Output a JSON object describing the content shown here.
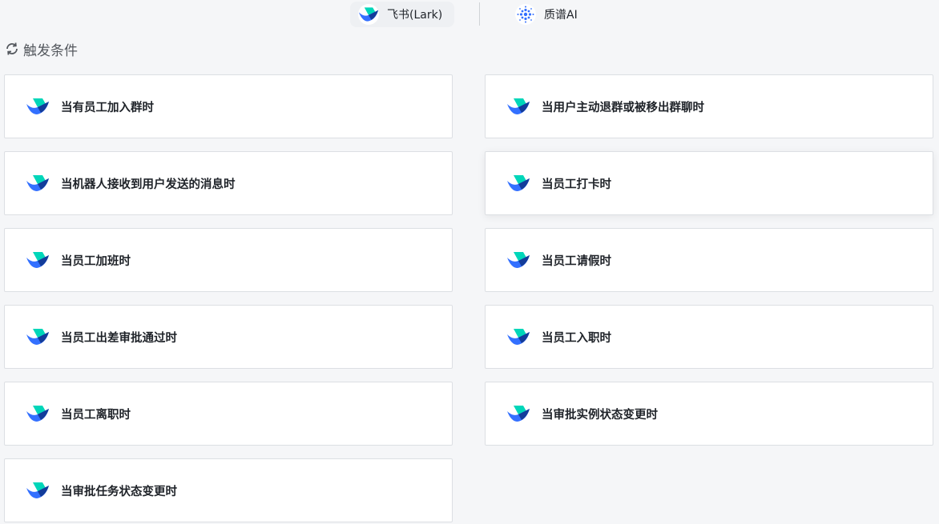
{
  "tabs": [
    {
      "label": "飞书(Lark)",
      "icon": "lark-logo-icon",
      "active": true
    },
    {
      "label": "质谱AI",
      "icon": "zhipu-ai-logo-icon",
      "active": false
    }
  ],
  "section": {
    "title": "触发条件",
    "icon": "refresh-icon"
  },
  "triggers": [
    {
      "label": "当有员工加入群时"
    },
    {
      "label": "当用户主动退群或被移出群聊时"
    },
    {
      "label": "当机器人接收到用户发送的消息时"
    },
    {
      "label": "当员工打卡时"
    },
    {
      "label": "当员工加班时"
    },
    {
      "label": "当员工请假时"
    },
    {
      "label": "当员工出差审批通过时"
    },
    {
      "label": "当员工入职时"
    },
    {
      "label": "当员工离职时"
    },
    {
      "label": "当审批实例状态变更时"
    },
    {
      "label": "当审批任务状态变更时"
    }
  ],
  "colors": {
    "brand_blue": "#3370ff",
    "brand_teal": "#00d6b9",
    "brand_navy": "#133c9a"
  }
}
